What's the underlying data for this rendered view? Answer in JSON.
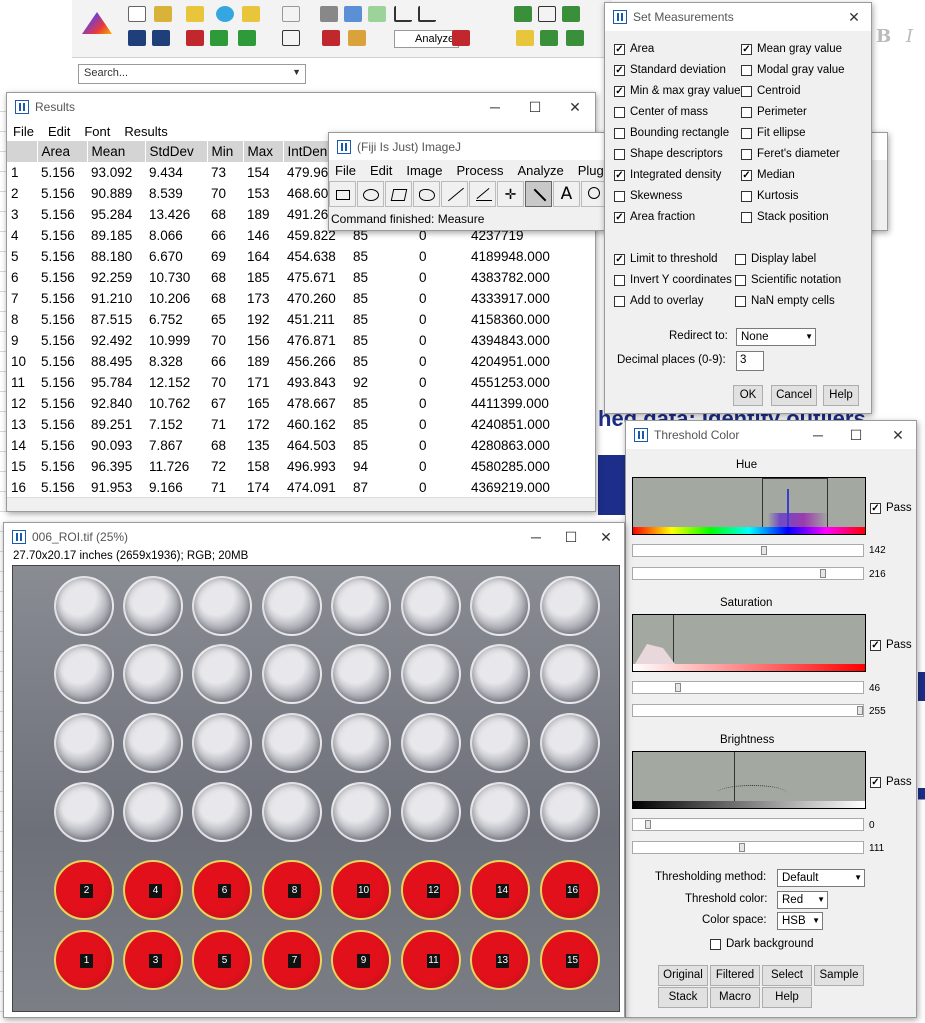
{
  "background_app": {
    "search_placeholder": "Search...",
    "analyze_label": "Analyze",
    "bold_glyph": "B",
    "italic_glyph": "I",
    "bg_text": "hed data: Identify outliers"
  },
  "results": {
    "title": "Results",
    "menu": [
      "File",
      "Edit",
      "Font",
      "Results"
    ],
    "columns": [
      "",
      "Area",
      "Mean",
      "StdDev",
      "Min",
      "Max",
      "IntDen"
    ],
    "rows": [
      [
        "1",
        "5.156",
        "93.092",
        "9.434",
        "73",
        "154",
        "479.96",
        "",
        "",
        ""
      ],
      [
        "2",
        "5.156",
        "90.889",
        "8.539",
        "70",
        "153",
        "468.60",
        "",
        "",
        ""
      ],
      [
        "3",
        "5.156",
        "95.284",
        "13.426",
        "68",
        "189",
        "491.26",
        "",
        "",
        ""
      ],
      [
        "4",
        "5.156",
        "89.185",
        "8.066",
        "66",
        "146",
        "459.822",
        "85",
        "0",
        "4237719"
      ],
      [
        "5",
        "5.156",
        "88.180",
        "6.670",
        "69",
        "164",
        "454.638",
        "85",
        "0",
        "4189948.000"
      ],
      [
        "6",
        "5.156",
        "92.259",
        "10.730",
        "68",
        "185",
        "475.671",
        "85",
        "0",
        "4383782.000"
      ],
      [
        "7",
        "5.156",
        "91.210",
        "10.206",
        "68",
        "173",
        "470.260",
        "85",
        "0",
        "4333917.000"
      ],
      [
        "8",
        "5.156",
        "87.515",
        "6.752",
        "65",
        "192",
        "451.211",
        "85",
        "0",
        "4158360.000"
      ],
      [
        "9",
        "5.156",
        "92.492",
        "10.999",
        "70",
        "156",
        "476.871",
        "85",
        "0",
        "4394843.000"
      ],
      [
        "10",
        "5.156",
        "88.495",
        "8.328",
        "66",
        "189",
        "456.266",
        "85",
        "0",
        "4204951.000"
      ],
      [
        "11",
        "5.156",
        "95.784",
        "12.152",
        "70",
        "171",
        "493.843",
        "92",
        "0",
        "4551253.000"
      ],
      [
        "12",
        "5.156",
        "92.840",
        "10.762",
        "67",
        "165",
        "478.667",
        "85",
        "0",
        "4411399.000"
      ],
      [
        "13",
        "5.156",
        "89.251",
        "7.152",
        "71",
        "172",
        "460.162",
        "85",
        "0",
        "4240851.000"
      ],
      [
        "14",
        "5.156",
        "90.093",
        "7.867",
        "68",
        "135",
        "464.503",
        "85",
        "0",
        "4280863.000"
      ],
      [
        "15",
        "5.156",
        "96.395",
        "11.726",
        "72",
        "158",
        "496.993",
        "94",
        "0",
        "4580285.000"
      ],
      [
        "16",
        "5.156",
        "91.953",
        "9.166",
        "71",
        "174",
        "474.091",
        "87",
        "0",
        "4369219.000"
      ]
    ]
  },
  "imagej": {
    "title": "(Fiji Is Just) ImageJ",
    "menu": [
      "File",
      "Edit",
      "Image",
      "Process",
      "Analyze",
      "Plugi"
    ],
    "status": "Command finished: Measure"
  },
  "set_measurements": {
    "title": "Set Measurements",
    "left": [
      {
        "label": "Area",
        "checked": true
      },
      {
        "label": "Standard deviation",
        "checked": true
      },
      {
        "label": "Min & max gray value",
        "checked": true
      },
      {
        "label": "Center of mass",
        "checked": false
      },
      {
        "label": "Bounding rectangle",
        "checked": false
      },
      {
        "label": "Shape descriptors",
        "checked": false
      },
      {
        "label": "Integrated density",
        "checked": true
      },
      {
        "label": "Skewness",
        "checked": false
      },
      {
        "label": "Area fraction",
        "checked": true
      }
    ],
    "right": [
      {
        "label": "Mean gray value",
        "checked": true
      },
      {
        "label": "Modal gray value",
        "checked": false
      },
      {
        "label": "Centroid",
        "checked": false
      },
      {
        "label": "Perimeter",
        "checked": false
      },
      {
        "label": "Fit ellipse",
        "checked": false
      },
      {
        "label": "Feret's diameter",
        "checked": false
      },
      {
        "label": "Median",
        "checked": true
      },
      {
        "label": "Kurtosis",
        "checked": false
      },
      {
        "label": "Stack position",
        "checked": false
      }
    ],
    "opt_left": [
      {
        "label": "Limit to threshold",
        "checked": true
      },
      {
        "label": "Invert Y coordinates",
        "checked": false
      },
      {
        "label": "Add to overlay",
        "checked": false
      }
    ],
    "opt_right": [
      {
        "label": "Display label",
        "checked": false
      },
      {
        "label": "Scientific notation",
        "checked": false
      },
      {
        "label": "NaN empty cells",
        "checked": false
      }
    ],
    "redirect_label": "Redirect to:",
    "redirect_value": "None",
    "decimal_label": "Decimal places (0-9):",
    "decimal_value": "3",
    "ok": "OK",
    "cancel": "Cancel",
    "help": "Help"
  },
  "threshold": {
    "title": "Threshold Color",
    "hue_label": "Hue",
    "sat_label": "Saturation",
    "bri_label": "Brightness",
    "pass_label": "Pass",
    "hue_min": "142",
    "hue_max": "216",
    "sat_min": "46",
    "sat_max": "255",
    "bri_min": "0",
    "bri_max": "111",
    "method_label": "Thresholding method:",
    "method_value": "Default",
    "color_label": "Threshold color:",
    "color_value": "Red",
    "space_label": "Color space:",
    "space_value": "HSB",
    "dark_bg_label": "Dark background",
    "buttons": [
      "Original",
      "Filtered",
      "Select",
      "Sample",
      "Stack",
      "Macro",
      "Help"
    ]
  },
  "image_window": {
    "title": "006_ROI.tif (25%)",
    "info": "27.70x20.17 inches (2659x1936); RGB; 20MB",
    "well_labels_top": [
      "2",
      "4",
      "6",
      "8",
      "10",
      "12",
      "14",
      "16"
    ],
    "well_labels_bottom": [
      "1",
      "3",
      "5",
      "7",
      "9",
      "11",
      "13",
      "15"
    ]
  },
  "colors": {
    "accent_blue": "#1d2e8a",
    "threshold_red": "#e2101a"
  }
}
